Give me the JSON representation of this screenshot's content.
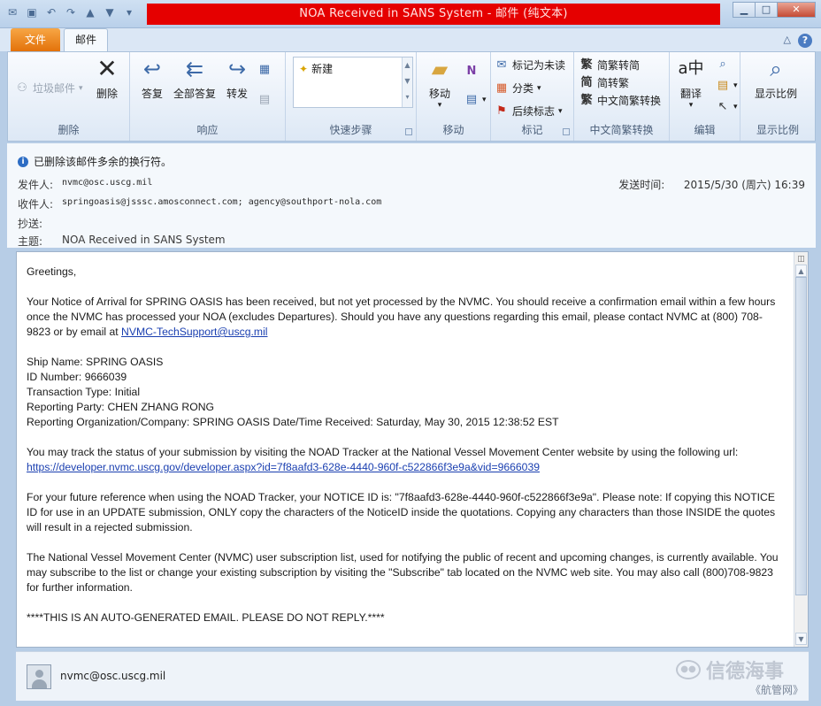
{
  "window": {
    "title": "NOA Received in SANS System  -  邮件 (纯文本)",
    "controls": [
      "minimize-icon",
      "maximize-icon",
      "close-icon"
    ]
  },
  "quick_access": [
    "mail-icon",
    "save-icon",
    "undo-icon",
    "redo-icon",
    "up-arrow-icon",
    "down-arrow-icon",
    "customize-icon"
  ],
  "tabs": {
    "file": "文件",
    "mail": "邮件"
  },
  "ribbon": {
    "delete_group": {
      "junk": "垃圾邮件",
      "delete": "删除",
      "label": "删除"
    },
    "respond_group": {
      "reply": "答复",
      "reply_all": "全部答复",
      "forward": "转发",
      "label": "响应"
    },
    "quick_steps": {
      "new": "新建",
      "label": "快速步骤"
    },
    "move_group": {
      "move": "移动",
      "label": "移动"
    },
    "tags_group": {
      "mark_unread": "标记为未读",
      "categorize": "分类",
      "follow_up": "后续标志",
      "label": "标记"
    },
    "chinese_group": {
      "to_traditional": "简繁转简",
      "to_simplified": "简转繁",
      "convert": "中文简繁转换",
      "label": "中文简繁转换"
    },
    "edit_group": {
      "translate": "翻译",
      "label": "编辑"
    },
    "zoom_group": {
      "zoom": "显示比例",
      "label": "显示比例"
    }
  },
  "header": {
    "info": "已删除该邮件多余的换行符。",
    "from_label": "发件人:",
    "from": "nvmc@osc.uscg.mil",
    "to_label": "收件人:",
    "to": "springoasis@jsssc.amosconnect.com; agency@southport-nola.com",
    "cc_label": "抄送:",
    "subject_label": "主题:",
    "subject": "NOA Received in SANS System",
    "sent_label": "发送时间:",
    "sent": "2015/5/30 (周六) 16:39"
  },
  "body": {
    "greeting": "Greetings,",
    "p1": "Your Notice of Arrival for SPRING OASIS has been received, but not yet processed by the NVMC.     You should receive a confirmation email within a few hours once the NVMC has processed your NOA (excludes Departures).     Should you have any questions regarding this email, please contact NVMC at (800) 708-9823 or by email at ",
    "p1_link": "NVMC-TechSupport@uscg.mil",
    "ship_name": "Ship Name: SPRING OASIS",
    "id_number": "ID Number: 9666039",
    "transaction": "Transaction Type: Initial",
    "party": "Reporting Party: CHEN ZHANG RONG",
    "org": "Reporting Organization/Company: SPRING OASIS Date/Time Received: Saturday, May 30, 2015 12:38:52 EST",
    "p3": "You may track the status of your submission by visiting the NOAD Tracker at the National Vessel Movement Center website by using the following url:",
    "p3_link": "https://developer.nvmc.uscg.gov/developer.aspx?id=7f8aafd3-628e-4440-960f-c522866f3e9a&vid=9666039",
    "p4": "For your future reference when using the NOAD Tracker, your NOTICE ID is:     \"7f8aafd3-628e-4440-960f-c522866f3e9a\".     Please note:     If copying this NOTICE ID for use in an UPDATE submission, ONLY copy the characters of the NoticeID inside the quotations.     Copying any characters than those INSIDE the quotes will result in a rejected submission.",
    "p5": "The National Vessel Movement Center (NVMC) user subscription list, used for notifying the public of recent and upcoming changes, is currently available. You may subscribe to the list or change your existing subscription by visiting the \"Subscribe\" tab located on the NVMC web site. You may also call (800)708-9823 for further information.",
    "p6": "****THIS IS AN AUTO-GENERATED EMAIL.     PLEASE DO NOT REPLY.****"
  },
  "people_pane": {
    "email": "nvmc@osc.uscg.mil"
  },
  "watermark": {
    "text": "信德海事",
    "source": "《航管网》"
  }
}
